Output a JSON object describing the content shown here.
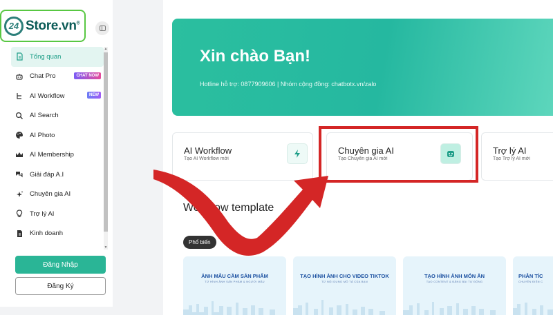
{
  "brand": {
    "logo_mark": "24",
    "name": "Store.vn",
    "reg": "®"
  },
  "sidebar": {
    "items": [
      {
        "label": "Tổng quan",
        "icon": "document-icon",
        "active": true
      },
      {
        "label": "Chat Pro",
        "icon": "robot-icon",
        "badge": "CHAT NOW"
      },
      {
        "label": "AI Workflow",
        "icon": "workflow-icon",
        "badge": "NEW"
      },
      {
        "label": "AI Search",
        "icon": "search-icon"
      },
      {
        "label": "AI Photo",
        "icon": "palette-icon"
      },
      {
        "label": "AI Membership",
        "icon": "crown-icon"
      },
      {
        "label": "Giải đáp A.I",
        "icon": "chat-bubbles-icon"
      },
      {
        "label": "Chuyên gia AI",
        "icon": "sparkle-icon"
      },
      {
        "label": "Trợ lý AI",
        "icon": "lightbulb-icon"
      },
      {
        "label": "Kinh doanh",
        "icon": "document-icon"
      }
    ],
    "login_label": "Đăng Nhập",
    "register_label": "Đăng Ký"
  },
  "hero": {
    "title": "Xin chào Bạn!",
    "subtitle": "Hotline hỗ trợ: 0877909606 | Nhóm cộng đồng: chatbotx.vn/zalo"
  },
  "cards": [
    {
      "title": "AI Workflow",
      "subtitle": "Tạo AI Workflow mới",
      "icon": "lightning-icon"
    },
    {
      "title": "Chuyên gia AI",
      "subtitle": "Tạo Chuyên gia AI mới",
      "icon": "bot-face-icon"
    },
    {
      "title": "Trợ lý AI",
      "subtitle": "Tạo Trợ lý AI mới",
      "icon": "assistant-icon"
    }
  ],
  "section": {
    "title": "Workflow template",
    "chip": "Phổ biến"
  },
  "templates": [
    {
      "title": "ẢNH MẪU CẦM SẢN PHẨM",
      "subtitle": "TỪ HÌNH ẢNH SẢN PHẨM & NGƯỜI MẪU"
    },
    {
      "title": "TẠO HÌNH ẢNH CHO VIDEO TIKTOK",
      "subtitle": "TỪ NỘI DUNG MÔ TẢ CỦA BẠN"
    },
    {
      "title": "TẠO HÌNH ẢNH MÓN ĂN",
      "subtitle": "TẠO CONTENT & ĐĂNG BÀI TỰ ĐỘNG"
    },
    {
      "title": "PHÂN TÍC",
      "subtitle": "CHUYÊN ĐIỆN C"
    }
  ],
  "colors": {
    "accent": "#2ab596",
    "highlight": "#d42626",
    "arrow": "#d42626"
  }
}
